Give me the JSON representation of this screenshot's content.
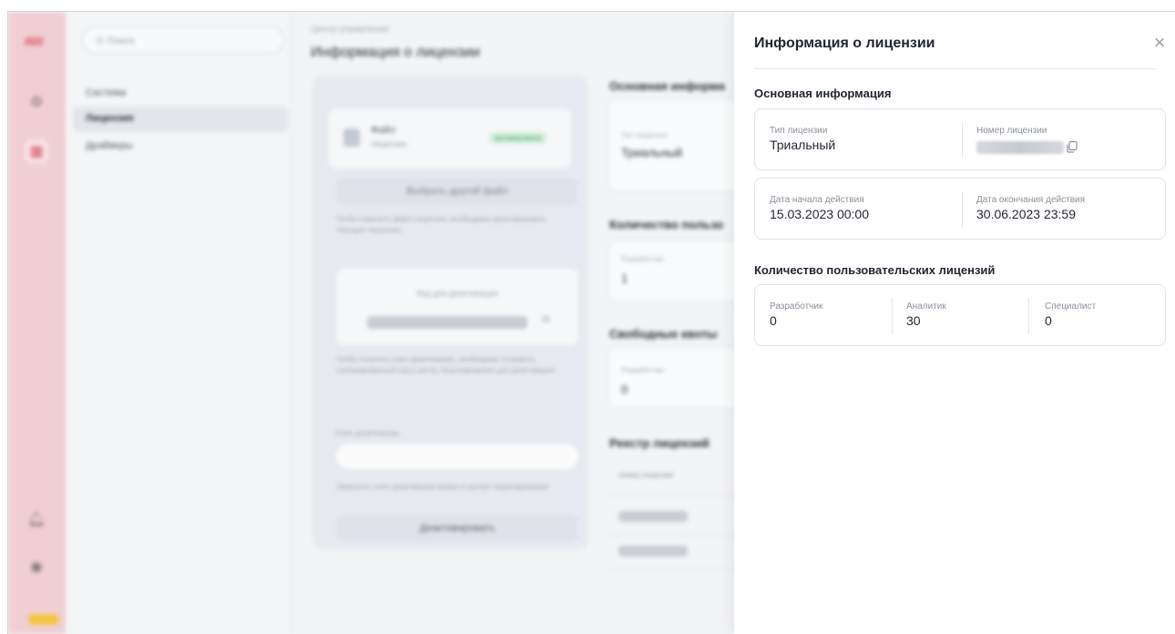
{
  "background_app": {
    "logo": "AW",
    "search_placeholder": "Поиск",
    "nav_items": [
      {
        "label": "Система",
        "selected": false
      },
      {
        "label": "Лицензия",
        "selected": true
      },
      {
        "label": "Драйверы",
        "selected": false
      }
    ],
    "breadcrumb": "Центр управления",
    "page_title": "Информация о лицензии",
    "file_title": "Файл",
    "file_subtitle": "лицензии",
    "file_badge": "активирована",
    "choose_file_button": "Выбрать другой файл",
    "choose_file_hint": "Чтобы изменить файл лицензии, необходимо деактивировать текущую лицензию",
    "deactivation_code_label": "Код для деактивации",
    "deactivation_hint": "Чтобы получить ключ деактивации, необходимо отправить сгенерированный код в центр лицензирования для деактивации",
    "deactivation_key_label": "Ключ деактивации",
    "request_key_hint": "Запросить ключ деактивации можно в центре лицензирования",
    "deactivate_button": "Деактивировать",
    "section_main": "Основная информа",
    "license_type_small": "Тип лицензии",
    "license_type_value": "Триальный",
    "section_users": "Количество пользо",
    "developer_small": "Разработчик",
    "developer_value": "1",
    "section_free": "Свободные квоты",
    "free_developer_small": "Разработчик",
    "free_developer_value": "0",
    "section_registry": "Реестр лицензий",
    "registry_column": "номер лицензии"
  },
  "drawer": {
    "title": "Информация о лицензии",
    "section_main": "Основная информация",
    "license_type_label": "Тип лицензии",
    "license_type_value": "Триальный",
    "license_number_label": "Номер лицензии",
    "start_date_label": "Дата начала действия",
    "start_date_value": "15.03.2023 00:00",
    "end_date_label": "Дата окончания действия",
    "end_date_value": "30.06.2023 23:59",
    "section_users": "Количество пользовательских лицензий",
    "users": [
      {
        "label": "Разработчик",
        "value": "0"
      },
      {
        "label": "Аналитик",
        "value": "30"
      },
      {
        "label": "Специалист",
        "value": "0"
      }
    ]
  },
  "colors": {
    "rail_bg": "#efcfd3",
    "accent": "#d94a5e",
    "toggle": "#f5c542"
  },
  "icons": [
    "settings-icon",
    "license-icon",
    "bell-icon",
    "user-icon",
    "copy-icon",
    "close-icon",
    "file-icon",
    "search-icon"
  ]
}
